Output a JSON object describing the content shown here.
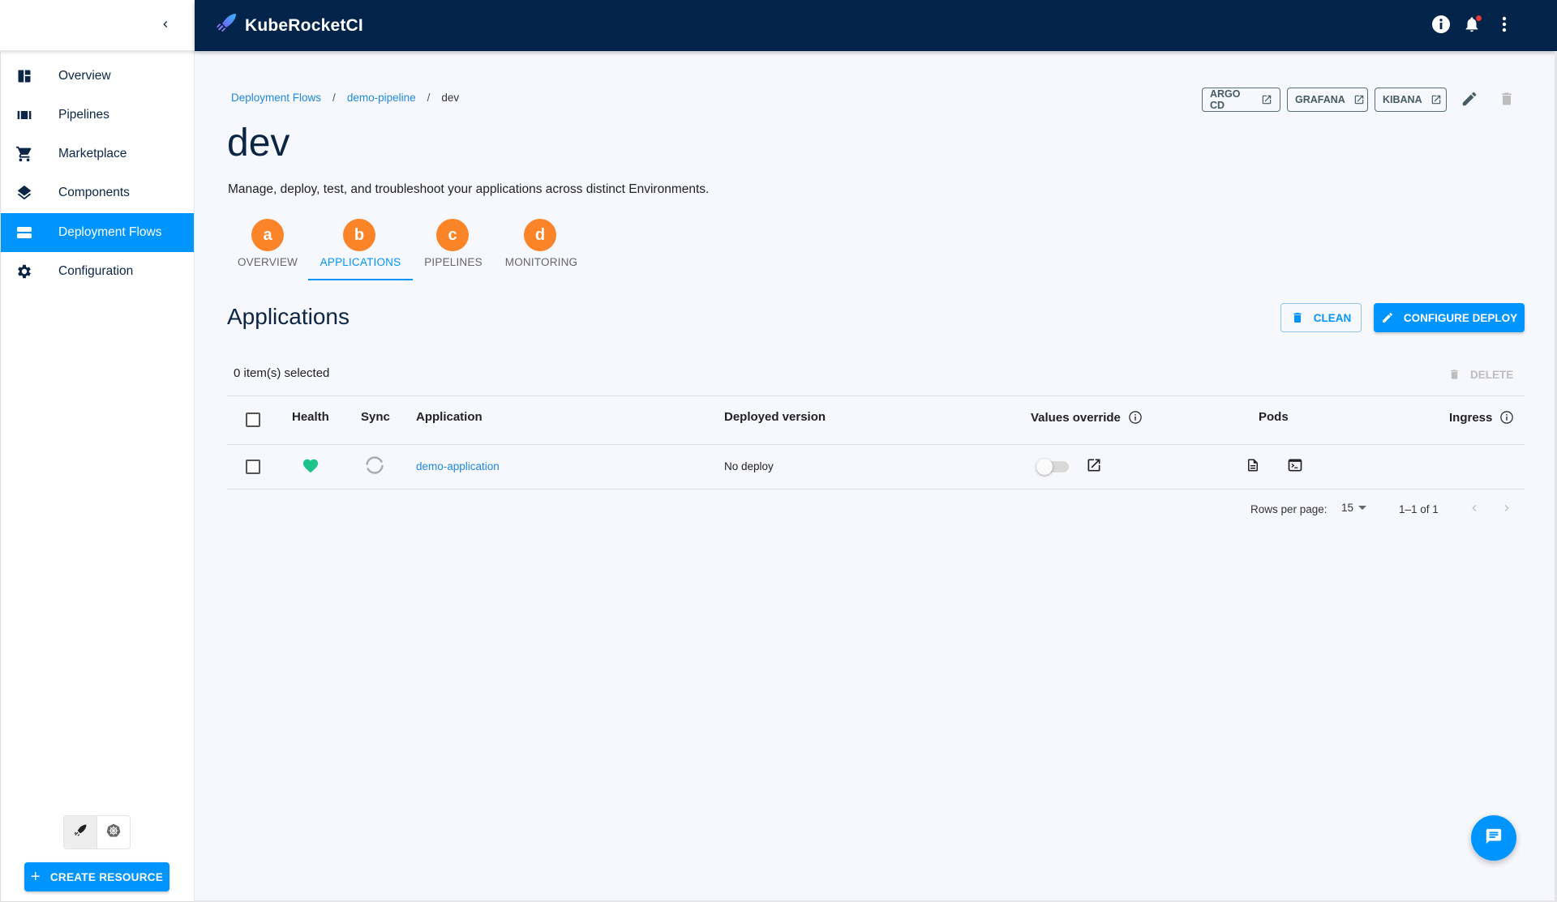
{
  "app": {
    "brand": "KubeRocketCI"
  },
  "colors": {
    "header_bg": "#02234a",
    "accent": "#0094ff",
    "health_ok": "#1ec28b",
    "annotation": "#fb8429"
  },
  "sidebar": {
    "collapse_icon": "chevron-left-icon",
    "items": [
      {
        "label": "Overview",
        "icon": "dashboard-icon",
        "active": false
      },
      {
        "label": "Pipelines",
        "icon": "pipelines-icon",
        "active": false
      },
      {
        "label": "Marketplace",
        "icon": "cart-icon",
        "active": false
      },
      {
        "label": "Components",
        "icon": "layers-icon",
        "active": false
      },
      {
        "label": "Deployment Flows",
        "icon": "stack-icon",
        "active": true
      },
      {
        "label": "Configuration",
        "icon": "gear-icon",
        "active": false
      }
    ],
    "mode_toggle": [
      {
        "icon": "rocket-icon",
        "selected": true
      },
      {
        "icon": "kubernetes-icon",
        "selected": false
      }
    ],
    "create_resource_label": "CREATE RESOURCE"
  },
  "header": {
    "icons": [
      "info-icon",
      "bell-icon",
      "more-vert-icon"
    ],
    "has_notification": true
  },
  "breadcrumb": {
    "items": [
      {
        "label": "Deployment Flows",
        "link": true
      },
      {
        "label": "demo-pipeline",
        "link": true
      },
      {
        "label": "dev",
        "link": false
      }
    ]
  },
  "page": {
    "title": "dev",
    "description": "Manage, deploy, test, and troubleshoot your applications across distinct Environments."
  },
  "external_links": [
    {
      "label": "ARGO CD"
    },
    {
      "label": "GRAFANA"
    },
    {
      "label": "KIBANA"
    }
  ],
  "tabs": [
    {
      "label": "OVERVIEW",
      "badge": "a",
      "active": false
    },
    {
      "label": "APPLICATIONS",
      "badge": "b",
      "active": true
    },
    {
      "label": "PIPELINES",
      "badge": "c",
      "active": false
    },
    {
      "label": "MONITORING",
      "badge": "d",
      "active": false
    }
  ],
  "applications": {
    "title": "Applications",
    "clean_label": "CLEAN",
    "configure_label": "CONFIGURE DEPLOY",
    "selected_text": "0 item(s) selected",
    "delete_label": "DELETE",
    "columns": [
      "Health",
      "Sync",
      "Application",
      "Deployed version",
      "Values override",
      "Pods",
      "Ingress"
    ],
    "rows": [
      {
        "health": "healthy",
        "sync": "unknown",
        "application": "demo-application",
        "deployed_version": "No deploy",
        "values_override": false
      }
    ],
    "pagination": {
      "rows_per_page_label": "Rows per page:",
      "rows_per_page": "15",
      "range": "1–1 of 1"
    }
  }
}
